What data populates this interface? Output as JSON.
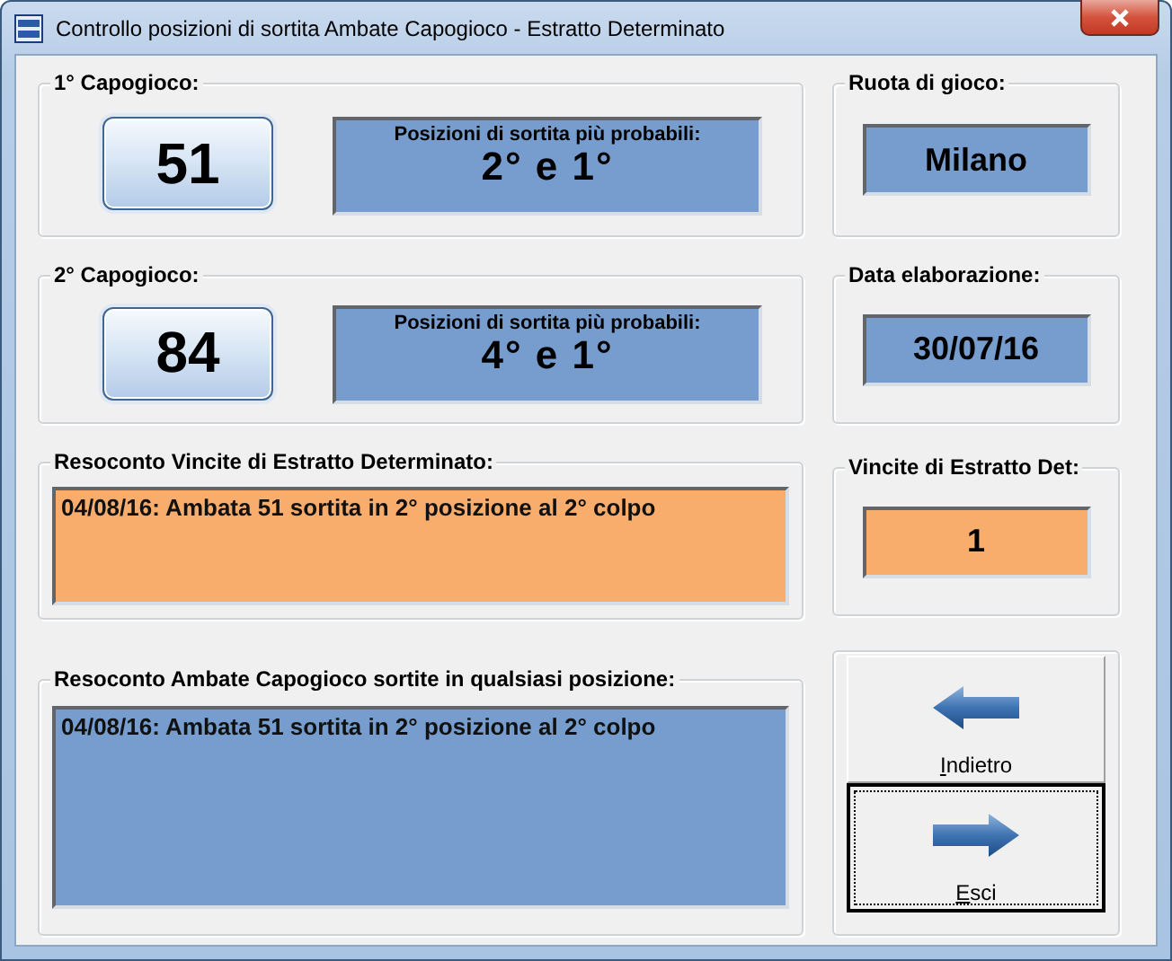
{
  "window": {
    "title": "Controllo posizioni di sortita Ambate Capogioco - Estratto Determinato"
  },
  "capogioco": [
    {
      "label": "1° Capogioco:",
      "number": "51",
      "positions_caption": "Posizioni di sortita più probabili:",
      "positions": "2° e 1°"
    },
    {
      "label": "2° Capogioco:",
      "number": "84",
      "positions_caption": "Posizioni di sortita più probabili:",
      "positions": "4° e 1°"
    }
  ],
  "ruota": {
    "label": "Ruota di gioco:",
    "value": "Milano"
  },
  "data_elaborazione": {
    "label": "Data elaborazione:",
    "value": "30/07/16"
  },
  "resoconto_estratto": {
    "label": "Resoconto Vincite di Estratto Determinato:",
    "lines": [
      "04/08/16: Ambata 51 sortita in 2° posizione al 2° colpo"
    ]
  },
  "vincite": {
    "label": "Vincite di Estratto Det:",
    "value": "1"
  },
  "resoconto_ambate": {
    "label": "Resoconto Ambate Capogioco sortite in qualsiasi posizione:",
    "lines": [
      "04/08/16: Ambata 51 sortita in 2° posizione al 2° colpo"
    ]
  },
  "buttons": [
    {
      "label": "Indietro",
      "kind": "back",
      "focused": false
    },
    {
      "label": "Esci",
      "kind": "exit",
      "focused": true
    }
  ]
}
